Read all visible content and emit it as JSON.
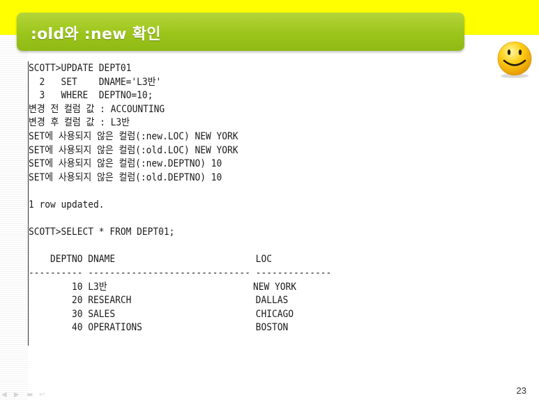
{
  "slide": {
    "title": ":old와 :new 확인",
    "page_number": "23"
  },
  "decorations": {
    "smiley_icon": "smiley-face-icon",
    "title_bar_color": "#9cc51b",
    "top_band_color": "#ffff00"
  },
  "console": {
    "lines": [
      "SCOTT>UPDATE DEPT01",
      "  2   SET    DNAME='L3반'",
      "  3   WHERE  DEPTNO=10;",
      "변경 전 컬럼 값 : ACCOUNTING",
      "변경 후 컬럼 값 : L3반",
      "SET에 사용되지 않은 컬럼(:new.LOC) NEW YORK",
      "SET에 사용되지 않은 컬럼(:old.LOC) NEW YORK",
      "SET에 사용되지 않은 컬럼(:new.DEPTNO) 10",
      "SET에 사용되지 않은 컬럼(:old.DEPTNO) 10",
      "",
      "1 row updated.",
      "",
      "SCOTT>SELECT * FROM DEPT01;",
      "",
      "    DEPTNO DNAME                          LOC",
      "---------- ------------------------------ --------------",
      "        10 L3반                           NEW YORK",
      "        20 RESEARCH                       DALLAS",
      "        30 SALES                          CHICAGO",
      "        40 OPERATIONS                     BOSTON"
    ]
  },
  "nav": {
    "prev": "◀",
    "next": "▶",
    "menu": "▬",
    "return": "↩"
  }
}
